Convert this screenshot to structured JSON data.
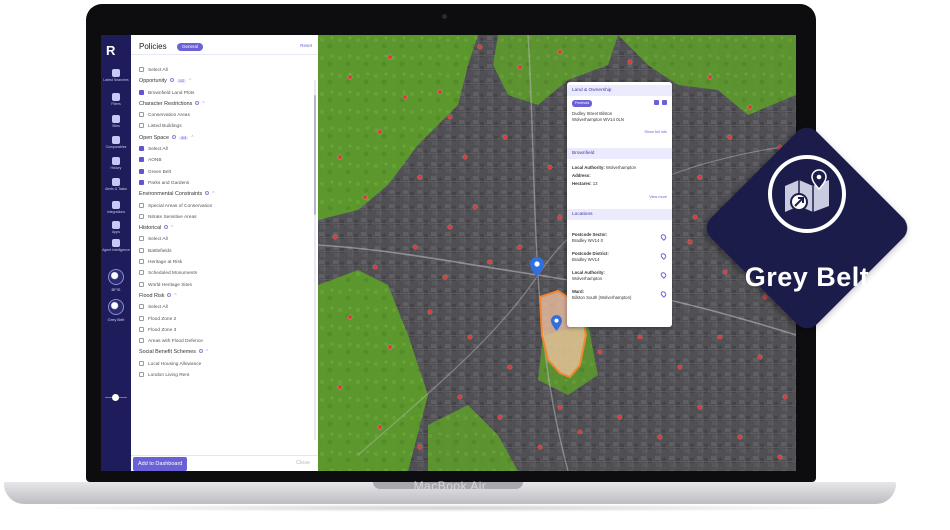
{
  "app": {
    "logo": "R"
  },
  "nav": [
    {
      "label": "Latest Searches"
    },
    {
      "label": "Filters"
    },
    {
      "label": "Sites"
    },
    {
      "label": "Comparables"
    },
    {
      "label": "History"
    },
    {
      "label": "Alerts & Tasks"
    },
    {
      "label": "Integrations"
    },
    {
      "label": "Apps"
    },
    {
      "label": "Agent Intelligence"
    }
  ],
  "nav_avatars": [
    {
      "label": "BFIS"
    },
    {
      "label": "Grey Belt"
    }
  ],
  "panel": {
    "title": "Policies",
    "pill": "General",
    "reset": "Reset",
    "add_button": "Add to Dashboard",
    "footer_link": "Close"
  },
  "policy_rows": [
    {
      "type": "item",
      "text": "Select All",
      "checked": false
    },
    {
      "type": "group",
      "text": "Opportunity",
      "tag": "1/2"
    },
    {
      "type": "item",
      "text": "Brownfield Land Plots",
      "checked": true
    },
    {
      "type": "group",
      "text": "Character Restrictions"
    },
    {
      "type": "item",
      "text": "Conservation Areas",
      "checked": false
    },
    {
      "type": "item",
      "text": "Listed Buildings",
      "checked": false
    },
    {
      "type": "group",
      "text": "Open Space",
      "tag": "4/4"
    },
    {
      "type": "item",
      "text": "Select All",
      "checked": true
    },
    {
      "type": "item",
      "text": "AONB",
      "checked": true
    },
    {
      "type": "item",
      "text": "Green Belt",
      "checked": true
    },
    {
      "type": "item",
      "text": "Parks and Gardens",
      "checked": true
    },
    {
      "type": "group",
      "text": "Environmental Constraints"
    },
    {
      "type": "item",
      "text": "Special Areas of Conservation",
      "checked": false
    },
    {
      "type": "item",
      "text": "Nitrate Sensitive Areas",
      "checked": false
    },
    {
      "type": "group",
      "text": "Historical"
    },
    {
      "type": "item",
      "text": "Select All",
      "checked": false
    },
    {
      "type": "item",
      "text": "Battlefields",
      "checked": false
    },
    {
      "type": "item",
      "text": "Heritage at Risk",
      "checked": false
    },
    {
      "type": "item",
      "text": "Scheduled Monuments",
      "checked": false
    },
    {
      "type": "item",
      "text": "World Heritage Sites",
      "checked": false
    },
    {
      "type": "group",
      "text": "Flood Risk"
    },
    {
      "type": "item",
      "text": "Select All",
      "checked": false
    },
    {
      "type": "item",
      "text": "Flood Zone 2",
      "checked": false
    },
    {
      "type": "item",
      "text": "Flood Zone 3",
      "checked": false
    },
    {
      "type": "item",
      "text": "Areas with Flood Defence",
      "checked": false
    },
    {
      "type": "group",
      "text": "Social Benefit Schemes"
    },
    {
      "type": "item",
      "text": "Local Housing Allowance",
      "checked": false
    },
    {
      "type": "item",
      "text": "London Living Rent",
      "checked": false
    }
  ],
  "card": {
    "section1": "Land & Ownership",
    "chip": "Freehold",
    "address_line1": "Dudley Street Bilston",
    "address_line2": "Wolverhampton WV14 0LN",
    "link1": "Show full info",
    "section2": "Brownfield",
    "la_label": "Local Authority:",
    "la_value": "Wolverhampton",
    "addr_label": "Address:",
    "hectares_label": "Hectares:",
    "hectares_value": "13",
    "link2": "View more",
    "section3": "Locations",
    "loc": [
      {
        "label": "Postcode Sector:",
        "value": "Bradley WV14 0"
      },
      {
        "label": "Postcode District:",
        "value": "Bradley WV14"
      },
      {
        "label": "Local Authority:",
        "value": "Wolverhampton"
      },
      {
        "label": "Ward:",
        "value": "Bilston South (Wolverhampton)"
      }
    ]
  },
  "laptop": {
    "brand": "MacBook Air"
  },
  "badge": {
    "label": "Grey Belt"
  },
  "colors": {
    "rail": "#1e1c5a",
    "accent": "#6b61d6",
    "green_belt": "#5e9e2e",
    "site_outline": "#f2862e",
    "marker": "#e23a3a",
    "badge_bg": "#1b1e4b"
  }
}
